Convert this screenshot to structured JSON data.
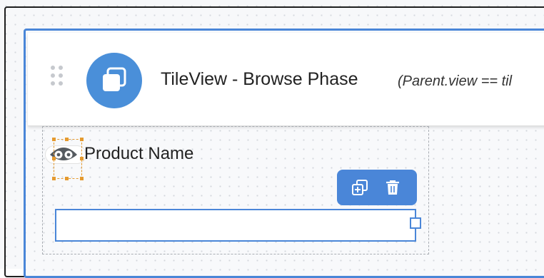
{
  "component": {
    "title": "TileView - Browse Phase",
    "condition": "(Parent.view == til",
    "icon": "layers-icon"
  },
  "field": {
    "label": "Product Name",
    "visibility_icon": "eye-icon"
  },
  "actions": {
    "duplicate_icon": "duplicate-icon",
    "delete_icon": "trash-icon"
  },
  "colors": {
    "accent": "#4a86d8",
    "selection": "#e59a2f"
  }
}
